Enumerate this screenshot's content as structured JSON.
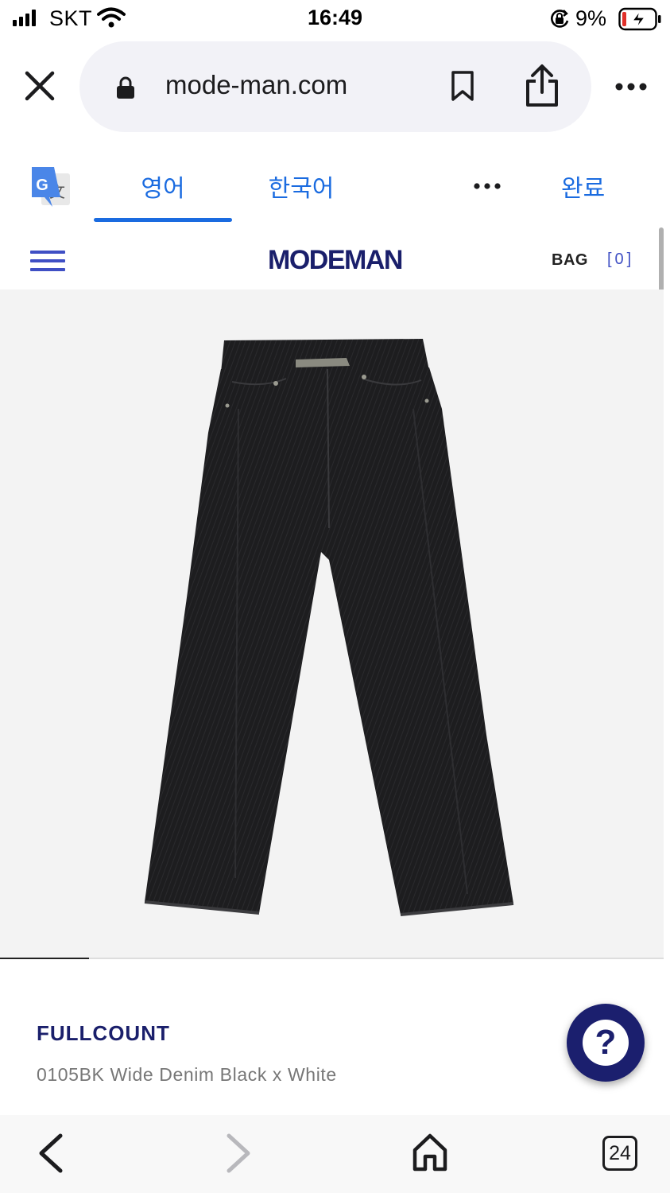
{
  "status_bar": {
    "carrier": "SKT",
    "time": "16:49",
    "battery_percent": "9%",
    "signal_bars": 4,
    "battery_level": 0.09
  },
  "browser": {
    "url": "mode-man.com",
    "icons": {
      "close": "close-icon",
      "lock": "lock-icon",
      "bookmark": "bookmark-icon",
      "share": "share-icon",
      "more": "more-icon"
    }
  },
  "translate_bar": {
    "icon": "google-translate-icon",
    "tabs": [
      {
        "label": "영어",
        "active": true
      },
      {
        "label": "한국어",
        "active": false
      }
    ],
    "done_label": "완료"
  },
  "site_header": {
    "logo": "MODEMAN",
    "bag_label": "BAG",
    "bag_count": "[0]"
  },
  "product": {
    "image": "black-denim-jeans-photo",
    "brand": "FULLCOUNT",
    "name": "0105BK Wide Denim Black x White",
    "gallery_position": 1
  },
  "help_button": {
    "label": "?"
  },
  "toolbar": {
    "tab_count": "24",
    "icons": {
      "back": "back-icon",
      "forward": "forward-icon",
      "home": "home-icon"
    }
  },
  "colors": {
    "accent": "#1a6be0",
    "brand_navy": "#1a1f6b",
    "menu_blue": "#3f4fc4"
  }
}
